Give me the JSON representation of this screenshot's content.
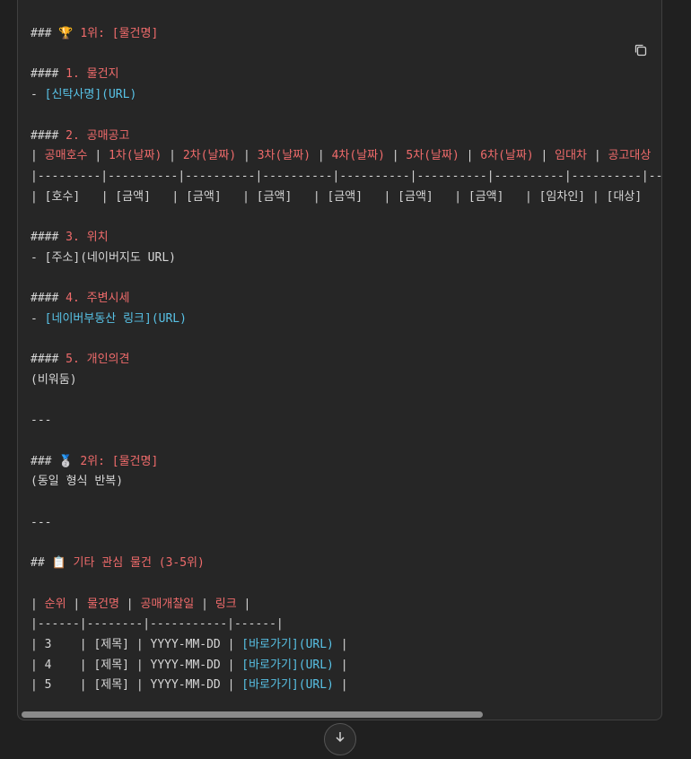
{
  "code": {
    "lines": [
      [
        {
          "t": "### ",
          "c": "p"
        },
        {
          "t": "🏆",
          "c": "e"
        },
        {
          "t": " 1위: [물건명]",
          "c": "h"
        }
      ],
      [],
      [
        {
          "t": "#### ",
          "c": "p"
        },
        {
          "t": "1. 물건지",
          "c": "h"
        }
      ],
      [
        {
          "t": "- ",
          "c": "p"
        },
        {
          "t": "[신탁사명](URL)",
          "c": "l"
        }
      ],
      [],
      [
        {
          "t": "#### ",
          "c": "p"
        },
        {
          "t": "2. 공매공고",
          "c": "h"
        }
      ],
      [
        {
          "t": "| ",
          "c": "p"
        },
        {
          "t": "공매호수",
          "c": "h"
        },
        {
          "t": " | ",
          "c": "p"
        },
        {
          "t": "1차(날짜)",
          "c": "h"
        },
        {
          "t": " | ",
          "c": "p"
        },
        {
          "t": "2차(날짜)",
          "c": "h"
        },
        {
          "t": " | ",
          "c": "p"
        },
        {
          "t": "3차(날짜)",
          "c": "h"
        },
        {
          "t": " | ",
          "c": "p"
        },
        {
          "t": "4차(날짜)",
          "c": "h"
        },
        {
          "t": " | ",
          "c": "p"
        },
        {
          "t": "5차(날짜)",
          "c": "h"
        },
        {
          "t": " | ",
          "c": "p"
        },
        {
          "t": "6차(날짜)",
          "c": "h"
        },
        {
          "t": " | ",
          "c": "p"
        },
        {
          "t": "임대차",
          "c": "h"
        },
        {
          "t": " | ",
          "c": "p"
        },
        {
          "t": "공고대상",
          "c": "h"
        }
      ],
      [
        {
          "t": "|---------|----------|----------|----------|----------|----------|----------|----------|----------|",
          "c": "p"
        }
      ],
      [
        {
          "t": "| [호수]   | [금액]   | [금액]   | [금액]   | [금액]   | [금액]   | [금액]   | [임차인] | [대상]",
          "c": "p"
        }
      ],
      [],
      [
        {
          "t": "#### ",
          "c": "p"
        },
        {
          "t": "3. 위치",
          "c": "h"
        }
      ],
      [
        {
          "t": "- [주소](네이버지도 URL)",
          "c": "p"
        }
      ],
      [],
      [
        {
          "t": "#### ",
          "c": "p"
        },
        {
          "t": "4. 주변시세",
          "c": "h"
        }
      ],
      [
        {
          "t": "- ",
          "c": "p"
        },
        {
          "t": "[네이버부동산 링크](URL)",
          "c": "l"
        }
      ],
      [],
      [
        {
          "t": "#### ",
          "c": "p"
        },
        {
          "t": "5. 개인의견",
          "c": "h"
        }
      ],
      [
        {
          "t": "(비워둠)",
          "c": "p"
        }
      ],
      [],
      [
        {
          "t": "---",
          "c": "p"
        }
      ],
      [],
      [
        {
          "t": "### ",
          "c": "p"
        },
        {
          "t": "🥈",
          "c": "e"
        },
        {
          "t": " 2위: [물건명]",
          "c": "h"
        }
      ],
      [
        {
          "t": "(동일 형식 반복)",
          "c": "p"
        }
      ],
      [],
      [
        {
          "t": "---",
          "c": "p"
        }
      ],
      [],
      [
        {
          "t": "## ",
          "c": "p"
        },
        {
          "t": "📋",
          "c": "e"
        },
        {
          "t": " 기타 관심 물건 (3-5위)",
          "c": "h"
        }
      ],
      [],
      [
        {
          "t": "| ",
          "c": "p"
        },
        {
          "t": "순위",
          "c": "h"
        },
        {
          "t": " | ",
          "c": "p"
        },
        {
          "t": "물건명",
          "c": "h"
        },
        {
          "t": " | ",
          "c": "p"
        },
        {
          "t": "공매개찰일",
          "c": "h"
        },
        {
          "t": " | ",
          "c": "p"
        },
        {
          "t": "링크",
          "c": "h"
        },
        {
          "t": " |",
          "c": "p"
        }
      ],
      [
        {
          "t": "|------|--------|-----------|------|",
          "c": "p"
        }
      ],
      [
        {
          "t": "| 3    | [제목] | YYYY-MM-DD | ",
          "c": "p"
        },
        {
          "t": "[바로가기](URL)",
          "c": "l"
        },
        {
          "t": " |",
          "c": "p"
        }
      ],
      [
        {
          "t": "| 4    | [제목] | YYYY-MM-DD | ",
          "c": "p"
        },
        {
          "t": "[바로가기](URL)",
          "c": "l"
        },
        {
          "t": " |",
          "c": "p"
        }
      ],
      [
        {
          "t": "| 5    | [제목] | YYYY-MM-DD | ",
          "c": "p"
        },
        {
          "t": "[바로가기](URL)",
          "c": "l"
        },
        {
          "t": " |",
          "c": "p"
        }
      ]
    ]
  },
  "icons": {
    "copy": "copy-icon",
    "scroll_down": "arrow-down-icon"
  },
  "colors": {
    "background": "#202020",
    "panel": "#262626",
    "text": "#d6d6d6",
    "heading": "#ef6b6b",
    "link": "#58c2e6"
  },
  "scroll": {
    "horizontal_position": 0
  }
}
